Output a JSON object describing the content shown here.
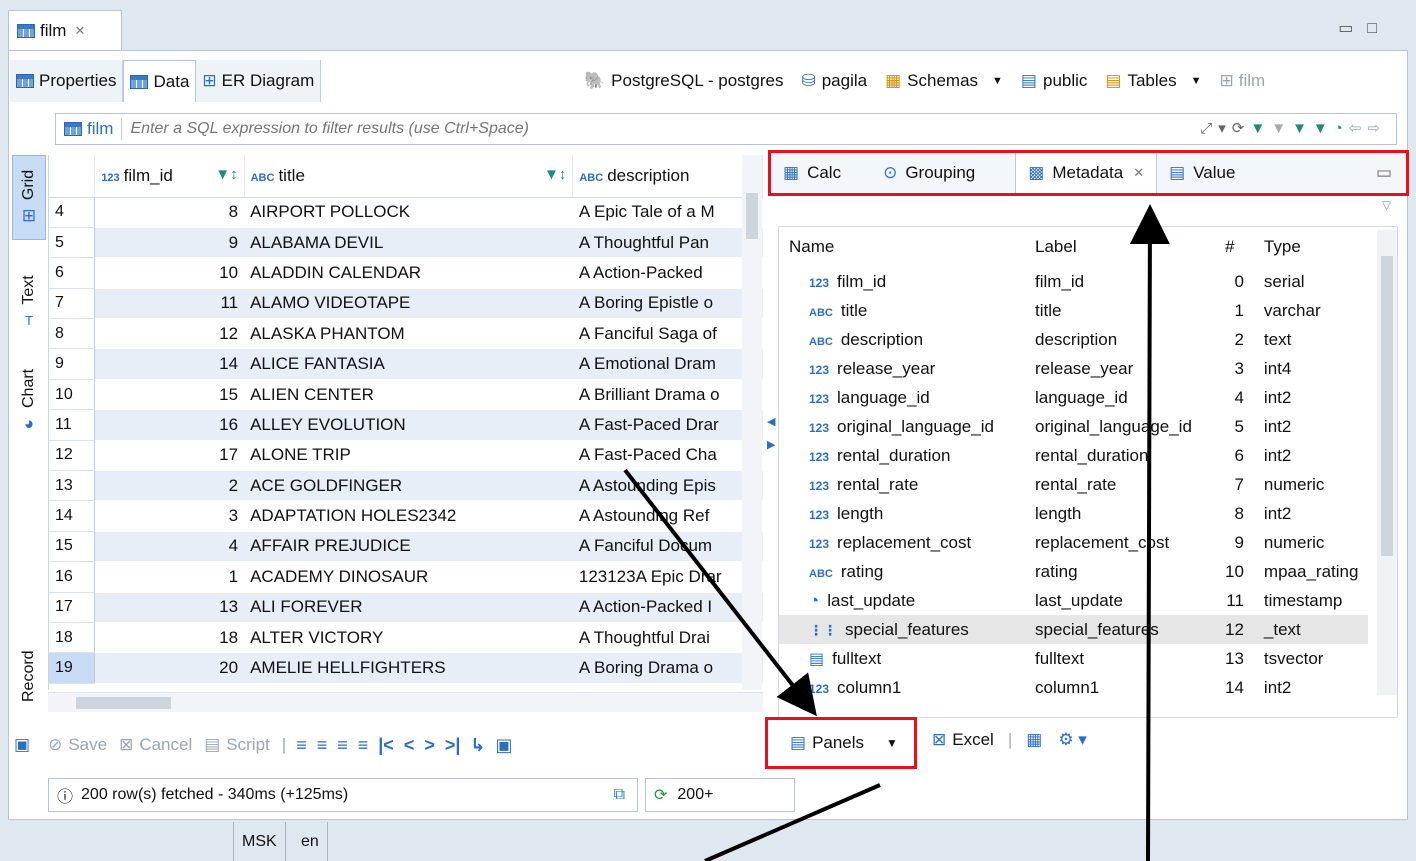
{
  "editor_tab": {
    "title": "film",
    "close": "✕"
  },
  "subtabs": [
    "Properties",
    "Data",
    "ER Diagram"
  ],
  "datasource": {
    "connection": "PostgreSQL - postgres",
    "database": "pagila",
    "schemas": "Schemas",
    "schema": "public",
    "tables": "Tables",
    "table": "film"
  },
  "filter": {
    "entity": "film",
    "placeholder": "Enter a SQL expression to filter results (use Ctrl+Space)"
  },
  "vertical_tabs": [
    "Grid",
    "Text",
    "Chart",
    "Record"
  ],
  "grid": {
    "columns": [
      {
        "type": "123",
        "name": "film_id"
      },
      {
        "type": "ABC",
        "name": "title"
      },
      {
        "type": "ABC",
        "name": "description"
      }
    ],
    "rows": [
      {
        "n": "4",
        "id": "8",
        "title": "AIRPORT POLLOCK",
        "desc": "A Epic Tale of a M"
      },
      {
        "n": "5",
        "id": "9",
        "title": "ALABAMA DEVIL",
        "desc": "A Thoughtful Pan"
      },
      {
        "n": "6",
        "id": "10",
        "title": "ALADDIN CALENDAR",
        "desc": "A Action-Packed "
      },
      {
        "n": "7",
        "id": "11",
        "title": "ALAMO VIDEOTAPE",
        "desc": "A Boring Epistle o"
      },
      {
        "n": "8",
        "id": "12",
        "title": "ALASKA PHANTOM",
        "desc": "A Fanciful Saga of"
      },
      {
        "n": "9",
        "id": "14",
        "title": "ALICE FANTASIA",
        "desc": "A Emotional Dram"
      },
      {
        "n": "10",
        "id": "15",
        "title": "ALIEN CENTER",
        "desc": "A Brilliant Drama o"
      },
      {
        "n": "11",
        "id": "16",
        "title": "ALLEY EVOLUTION",
        "desc": "A Fast-Paced Drar"
      },
      {
        "n": "12",
        "id": "17",
        "title": "ALONE TRIP",
        "desc": "A Fast-Paced Cha"
      },
      {
        "n": "13",
        "id": "2",
        "title": "ACE GOLDFINGER",
        "desc": "A Astounding Epis"
      },
      {
        "n": "14",
        "id": "3",
        "title": "ADAPTATION HOLES2342",
        "desc": "A Astounding Ref"
      },
      {
        "n": "15",
        "id": "4",
        "title": "AFFAIR PREJUDICE",
        "desc": "A Fanciful Docum"
      },
      {
        "n": "16",
        "id": "1",
        "title": "ACADEMY DINOSAUR",
        "desc": "123123A Epic Drar"
      },
      {
        "n": "17",
        "id": "13",
        "title": "ALI FOREVER",
        "desc": "A Action-Packed I"
      },
      {
        "n": "18",
        "id": "18",
        "title": "ALTER VICTORY",
        "desc": "A Thoughtful Drai"
      },
      {
        "n": "19",
        "id": "20",
        "title": "AMELIE HELLFIGHTERS",
        "desc": "A Boring Drama o"
      }
    ]
  },
  "panel_tabs": [
    "Calc",
    "Grouping",
    "Metadata",
    "Value"
  ],
  "metadata": {
    "headers": [
      "Name",
      "Label",
      "#",
      "Type"
    ],
    "rows": [
      {
        "icon": "123",
        "name": "film_id",
        "label": "film_id",
        "idx": "0",
        "type": "serial"
      },
      {
        "icon": "ABC",
        "name": "title",
        "label": "title",
        "idx": "1",
        "type": "varchar"
      },
      {
        "icon": "ABC",
        "name": "description",
        "label": "description",
        "idx": "2",
        "type": "text"
      },
      {
        "icon": "123",
        "name": "release_year",
        "label": "release_year",
        "idx": "3",
        "type": "int4"
      },
      {
        "icon": "123",
        "name": "language_id",
        "label": "language_id",
        "idx": "4",
        "type": "int2"
      },
      {
        "icon": "123",
        "name": "original_language_id",
        "label": "original_language_id",
        "idx": "5",
        "type": "int2"
      },
      {
        "icon": "123",
        "name": "rental_duration",
        "label": "rental_duration",
        "idx": "6",
        "type": "int2"
      },
      {
        "icon": "123",
        "name": "rental_rate",
        "label": "rental_rate",
        "idx": "7",
        "type": "numeric"
      },
      {
        "icon": "123",
        "name": "length",
        "label": "length",
        "idx": "8",
        "type": "int2"
      },
      {
        "icon": "123",
        "name": "replacement_cost",
        "label": "replacement_cost",
        "idx": "9",
        "type": "numeric"
      },
      {
        "icon": "ABC",
        "name": "rating",
        "label": "rating",
        "idx": "10",
        "type": "mpaa_rating"
      },
      {
        "icon": "clock",
        "name": "last_update",
        "label": "last_update",
        "idx": "11",
        "type": "timestamp"
      },
      {
        "icon": "array",
        "name": "special_features",
        "label": "special_features",
        "idx": "12",
        "type": "_text"
      },
      {
        "icon": "doc",
        "name": "fulltext",
        "label": "fulltext",
        "idx": "13",
        "type": "tsvector"
      },
      {
        "icon": "123",
        "name": "column1",
        "label": "column1",
        "idx": "14",
        "type": "int2"
      }
    ]
  },
  "toolbar": {
    "save": "Save",
    "cancel": "Cancel",
    "script": "Script",
    "panels": "Panels",
    "excel": "Excel"
  },
  "status": {
    "fetch": "200 row(s) fetched - 340ms (+125ms)",
    "count": "200+",
    "locale": "MSK",
    "lang": "en"
  },
  "colors": {
    "highlight_box": "#e8101b",
    "accent": "#2b6fc2",
    "row_alt": "#e7eef8"
  }
}
